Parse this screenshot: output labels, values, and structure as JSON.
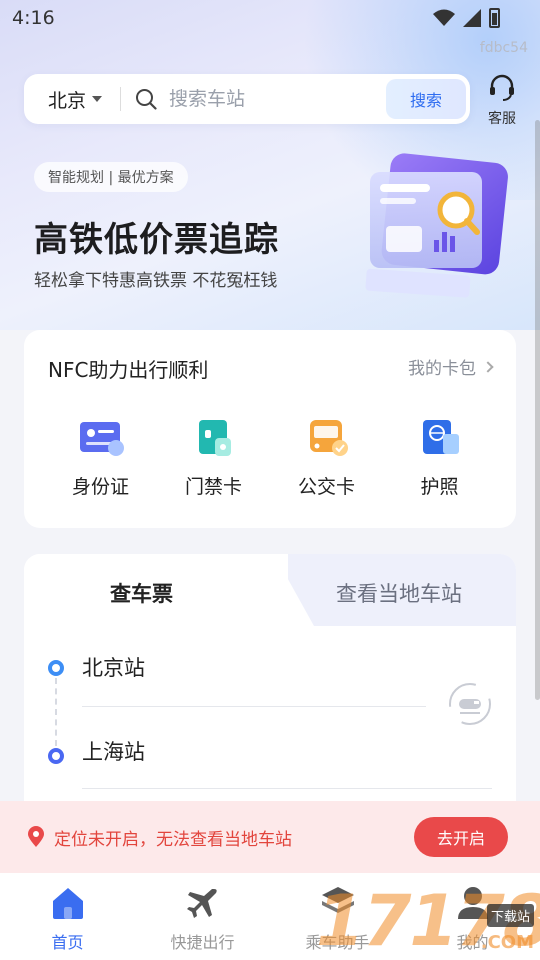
{
  "status_bar": {
    "time": "4:16",
    "device_id": "fdbc54"
  },
  "search": {
    "city": "北京",
    "placeholder": "搜索车站",
    "button_label": "搜索"
  },
  "service": {
    "label": "客服"
  },
  "banner": {
    "tag": "智能规划 | 最优方案",
    "title": "高铁低价票追踪",
    "subtitle": "轻松拿下特惠高铁票 不花冤枉钱"
  },
  "nfc": {
    "title": "NFC助力出行顺利",
    "wallet_link": "我的卡包",
    "items": [
      {
        "label": "身份证",
        "icon": "id-card-icon"
      },
      {
        "label": "门禁卡",
        "icon": "access-card-icon"
      },
      {
        "label": "公交卡",
        "icon": "bus-card-icon"
      },
      {
        "label": "护照",
        "icon": "passport-icon"
      }
    ]
  },
  "ticket": {
    "tabs": [
      "查车票",
      "查看当地车站"
    ],
    "from_station": "北京站",
    "to_station": "上海站"
  },
  "location_notice": {
    "text": "定位未开启，无法查看当地车站",
    "button_label": "去开启"
  },
  "bottom_nav": [
    {
      "label": "首页",
      "active": true
    },
    {
      "label": "快捷出行",
      "active": false
    },
    {
      "label": "乘车助手",
      "active": false
    },
    {
      "label": "我的",
      "active": false
    }
  ],
  "watermark": {
    "text": "17178",
    "badge": "下载站",
    "suffix": ".COM"
  },
  "colors": {
    "accent": "#3a6df0",
    "alert": "#e9494a",
    "alert_bg": "#fde9ea"
  }
}
